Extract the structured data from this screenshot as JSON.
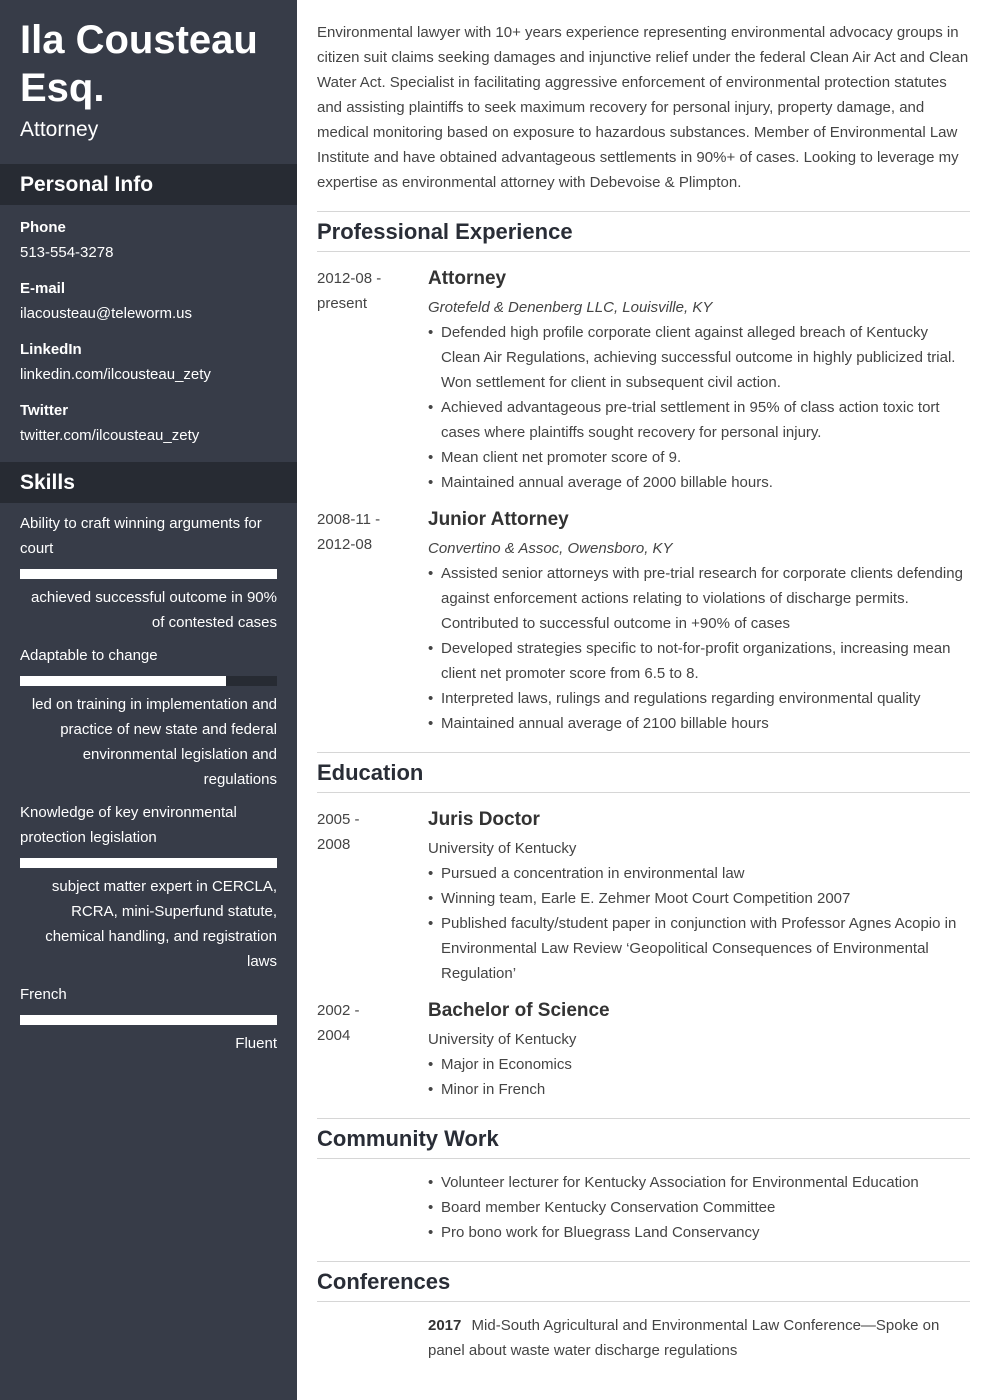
{
  "sidebar": {
    "name_line1": "Ila Cousteau",
    "name_line2": "Esq.",
    "role": "Attorney",
    "personal_info_heading": "Personal Info",
    "personal_info": [
      {
        "label": "Phone",
        "value": "513-554-3278"
      },
      {
        "label": "E-mail",
        "value": "ilacousteau@teleworm.us"
      },
      {
        "label": "LinkedIn",
        "value": "linkedin.com/ilcousteau_zety"
      },
      {
        "label": "Twitter",
        "value": "twitter.com/ilcousteau_zety"
      }
    ],
    "skills_heading": "Skills",
    "skills": [
      {
        "name": "Ability to craft winning arguments for court",
        "level_percent": 100,
        "description": "achieved successful outcome in 90% of contested cases"
      },
      {
        "name": "Adaptable to change",
        "level_percent": 80,
        "description": "led on training in implementation and practice of new state and federal environmental legislation and regulations"
      },
      {
        "name": "Knowledge of key environmental protection legislation",
        "level_percent": 100,
        "description": "subject matter expert in CERCLA, RCRA, mini-Superfund statute, chemical handling, and registration laws"
      },
      {
        "name": "French",
        "level_percent": 100,
        "description": "Fluent"
      }
    ],
    "colors": {
      "sidebar_bg": "#373c48",
      "band_bg": "#272b33",
      "text": "#ffffff"
    }
  },
  "main": {
    "summary": "Environmental lawyer with 10+ years experience representing environmental advocacy groups in citizen suit claims seeking damages and injunctive relief under the federal Clean Air Act and Clean Water Act. Specialist in facilitating aggressive enforcement of environmental protection statutes and assisting plaintiffs to seek maximum recovery for personal injury, property damage, and medical monitoring based on exposure to hazardous substances. Member of Environmental Law Institute and have obtained advantageous settlements in 90%+ of cases. Looking to leverage my expertise as environmental attorney with Debevoise & Plimpton.",
    "experience": {
      "heading": "Professional Experience",
      "entries": [
        {
          "date_line1": "2012-08 -",
          "date_line2": "present",
          "title": "Attorney",
          "org": "Grotefeld & Denenberg LLC, Louisville, KY",
          "bullets": [
            "Defended high profile corporate client against alleged breach of Kentucky Clean Air Regulations, achieving successful outcome in highly publicized trial. Won settlement for client in subsequent civil action.",
            "Achieved advantageous pre-trial settlement in 95% of class action toxic tort cases where plaintiffs sought recovery for personal injury.",
            "Mean client net promoter score of 9.",
            "Maintained annual average of 2000 billable hours."
          ]
        },
        {
          "date_line1": "2008-11 -",
          "date_line2": "2012-08",
          "title": "Junior Attorney",
          "org": "Convertino & Assoc, Owensboro, KY",
          "bullets": [
            "Assisted senior attorneys with pre-trial research for corporate clients defending against enforcement actions relating to violations of discharge permits. Contributed to successful outcome in +90% of cases",
            "Developed strategies specific to not-for-profit organizations, increasing mean client net promoter score from 6.5 to 8.",
            "Interpreted laws, rulings and regulations regarding environmental quality",
            "Maintained annual average of 2100 billable hours"
          ]
        }
      ]
    },
    "education": {
      "heading": "Education",
      "entries": [
        {
          "date_line1": "2005 -",
          "date_line2": "2008",
          "title": "Juris Doctor",
          "org": "University of Kentucky",
          "bullets": [
            "Pursued a concentration in environmental law",
            "Winning team, Earle E. Zehmer Moot Court Competition 2007",
            "Published faculty/student paper in conjunction with Professor Agnes Acopio in Environmental Law Review ‘Geopolitical Consequences of Environmental Regulation’"
          ]
        },
        {
          "date_line1": "2002 -",
          "date_line2": "2004",
          "title": "Bachelor of Science",
          "org": "University of Kentucky",
          "bullets": [
            "Major in Economics",
            "Minor in French"
          ]
        }
      ]
    },
    "community": {
      "heading": "Community Work",
      "bullets": [
        "Volunteer lecturer for Kentucky Association for Environmental Education",
        "Board member Kentucky Conservation Committee",
        "Pro bono work for Bluegrass Land Conservancy"
      ]
    },
    "conferences": {
      "heading": "Conferences",
      "entries": [
        {
          "year": "2017",
          "text": "Mid-South Agricultural and Environmental Law Conference—Spoke on panel about waste water discharge regulations"
        }
      ]
    }
  }
}
